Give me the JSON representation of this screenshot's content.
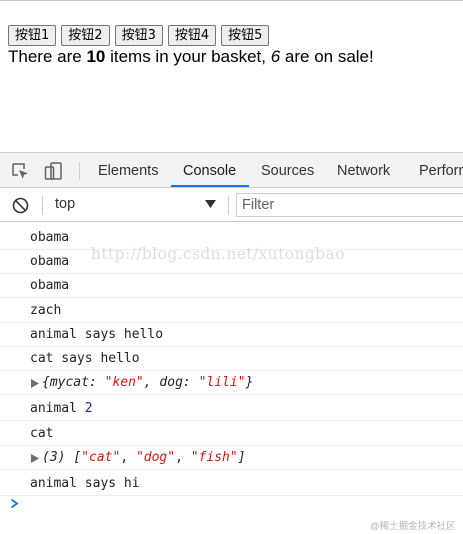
{
  "page": {
    "buttons": [
      "按钮1",
      "按钮2",
      "按钮3",
      "按钮4",
      "按钮5"
    ],
    "basket": {
      "before": "There are ",
      "count": "10",
      "middle": " items in your basket, ",
      "sale_count": "6",
      "after": " are on sale!"
    }
  },
  "devtools": {
    "tabs": [
      "Elements",
      "Console",
      "Sources",
      "Network",
      "Perform"
    ],
    "active_tab": "Console",
    "accent_color": "#1a73e8",
    "context": "top",
    "filter_placeholder": "Filter",
    "console": {
      "lines": {
        "l1": "obama",
        "l2": "obama",
        "l3": "obama",
        "l4": "zach",
        "l5": "animal says hello",
        "l6": "cat says hello",
        "l8_text": "animal ",
        "l8_num": "2",
        "l9": "cat",
        "l11": "animal says hi"
      },
      "object_line": {
        "open": "{",
        "key1": "mycat: ",
        "val1": "\"ken\"",
        "sep": ", ",
        "key2": "dog: ",
        "val2": "\"lili\"",
        "close": "}"
      },
      "array_line": {
        "count": "(3) ",
        "open": "[",
        "v1": "\"cat\"",
        "v2": "\"dog\"",
        "v3": "\"fish\"",
        "sep": ", ",
        "close": "]"
      },
      "watermark": "http://blog.csdn.net/xutongbao"
    }
  },
  "corner_mark": "@稀土掘金技术社区"
}
